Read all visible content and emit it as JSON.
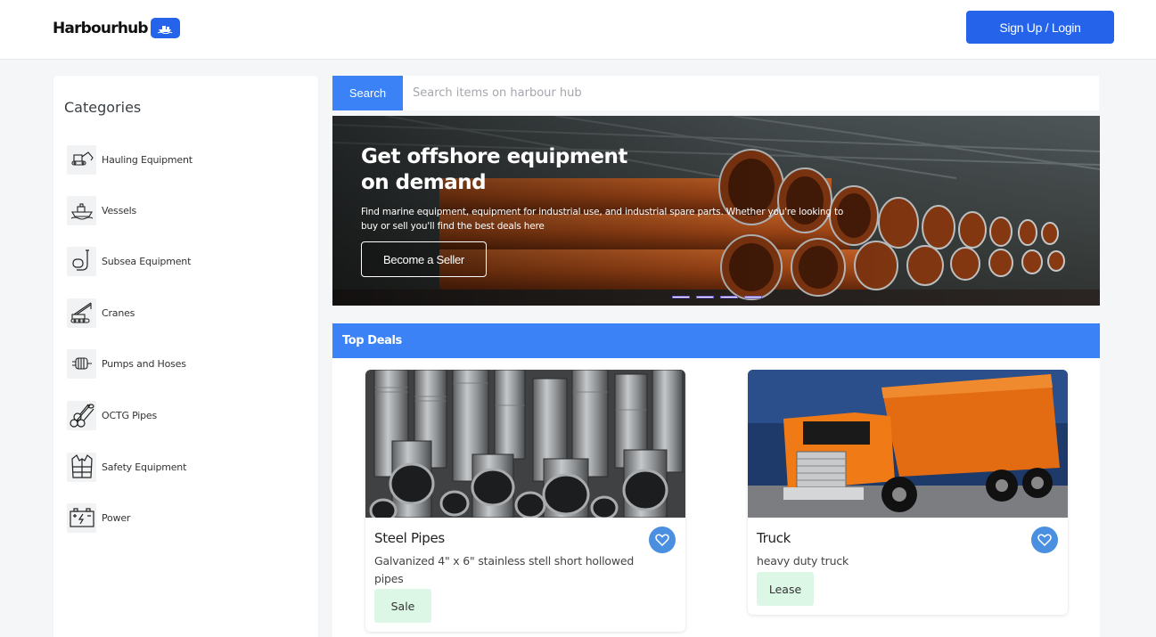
{
  "header": {
    "logo_text": "Harbourhub",
    "signup_label": "Sign Up / Login"
  },
  "sidebar": {
    "title": "Categories",
    "items": [
      {
        "label": "Hauling Equipment",
        "icon": "excavator-icon"
      },
      {
        "label": "Vessels",
        "icon": "vessel-icon"
      },
      {
        "label": "Subsea Equipment",
        "icon": "snorkel-icon"
      },
      {
        "label": "Cranes",
        "icon": "crane-icon"
      },
      {
        "label": "Pumps and Hoses",
        "icon": "pump-icon"
      },
      {
        "label": "OCTG Pipes",
        "icon": "pipes-icon"
      },
      {
        "label": "Safety Equipment",
        "icon": "safety-vest-icon"
      },
      {
        "label": "Power",
        "icon": "battery-icon"
      }
    ]
  },
  "search": {
    "button_label": "Search",
    "placeholder": "Search items on harbour hub"
  },
  "banner": {
    "heading": "Get offshore equipment on demand",
    "subtext": "Find marine equipment, equipment for industrial use, and industrial spare parts. Whether you're looking to buy or sell you'll find the best deals here",
    "cta_label": "Become a Seller",
    "slide_count": 4
  },
  "deals": {
    "title": "Top Deals",
    "items": [
      {
        "title": "Steel Pipes",
        "description": "Galvanized 4\" x 6\" stainless stell short hollowed pipes",
        "tag": "Sale"
      },
      {
        "title": "Truck",
        "description": "heavy duty truck",
        "tag": "Lease"
      }
    ]
  },
  "colors": {
    "primary": "#2563eb",
    "accent": "#3b82f6",
    "tag_bg": "#dcf7e6"
  }
}
